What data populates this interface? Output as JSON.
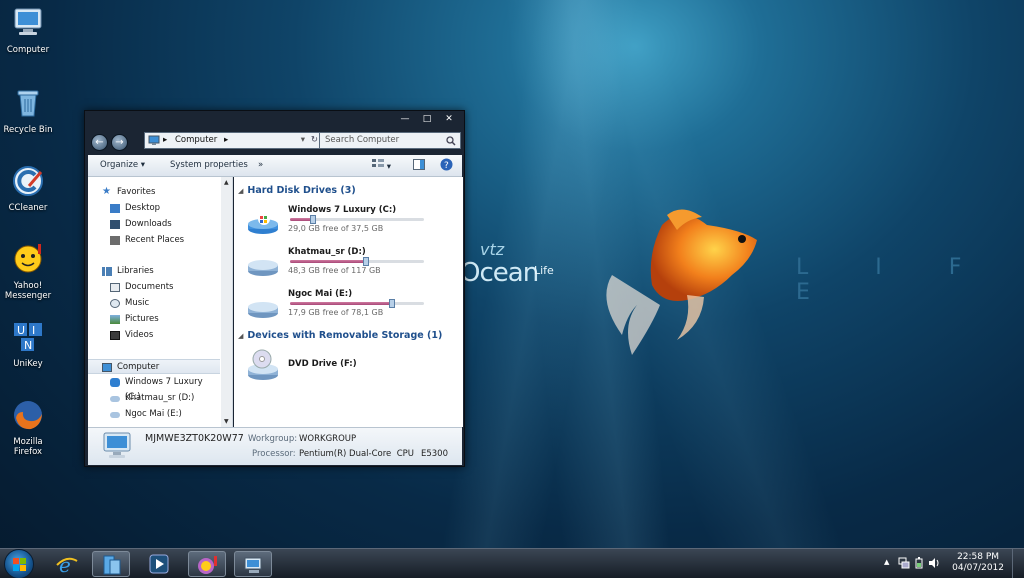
{
  "desktop": {
    "icons": [
      {
        "label": "Computer",
        "icon": "computer-icon"
      },
      {
        "label": "Recycle Bin",
        "icon": "recycle-bin-icon"
      },
      {
        "label": "CCleaner",
        "icon": "ccleaner-icon"
      },
      {
        "label": "Yahoo! Messenger",
        "icon": "yahoo-messenger-icon"
      },
      {
        "label": "UniKey",
        "icon": "unikey-icon"
      },
      {
        "label": "Mozilla Firefox",
        "icon": "firefox-icon"
      }
    ],
    "wallpaper": {
      "brand_small": "vtz",
      "brand_big": "Ocean",
      "brand_life": "Life",
      "side_word": "L I F E"
    }
  },
  "explorer": {
    "controls": {
      "minimize": "—",
      "maximize": "□",
      "close": "✕"
    },
    "nav": {
      "back": "←",
      "forward": "→"
    },
    "address": {
      "crumb": "Computer",
      "sep": "▸"
    },
    "search": {
      "placeholder": "Search Computer"
    },
    "commands": {
      "organize": "Organize",
      "system_properties": "System properties",
      "more": "»"
    },
    "nav_pane": {
      "favorites_header": "Favorites",
      "favorites": [
        "Desktop",
        "Downloads",
        "Recent Places"
      ],
      "libraries_header": "Libraries",
      "libraries": [
        "Documents",
        "Music",
        "Pictures",
        "Videos"
      ],
      "computer_header": "Computer",
      "computer": [
        "Windows 7 Luxury (C:)",
        "Khatmau_sr (D:)",
        "Ngoc Mai (E:)"
      ]
    },
    "groups": {
      "hard_disks": "Hard Disk Drives (3)",
      "removable": "Devices with Removable Storage (1)"
    },
    "drives": [
      {
        "name": "Windows 7 Luxury (C:)",
        "free": "29,0 GB free of 37,5 GB",
        "used_fraction": 0.17
      },
      {
        "name": "Khatmau_sr (D:)",
        "free": "48,3 GB free of 117 GB",
        "used_fraction": 0.57
      },
      {
        "name": "Ngoc Mai (E:)",
        "free": "17,9 GB free of 78,1 GB",
        "used_fraction": 0.76
      }
    ],
    "removable": [
      {
        "name": "DVD Drive (F:)"
      }
    ],
    "details": {
      "computer_name": "MJMWE3ZT0K20W77",
      "workgroup_label": "Workgroup:",
      "workgroup": "WORKGROUP",
      "processor_label": "Processor:",
      "processor": "Pentium(R) Dual-Core  CPU",
      "processor_model": "E5300"
    }
  },
  "taskbar": {
    "clock_time": "22:58 PM",
    "clock_date": "04/07/2012",
    "tray_arrow": "▲"
  },
  "colors": {
    "accent": "#1f4f8c",
    "window_frame": "#1b2533"
  }
}
